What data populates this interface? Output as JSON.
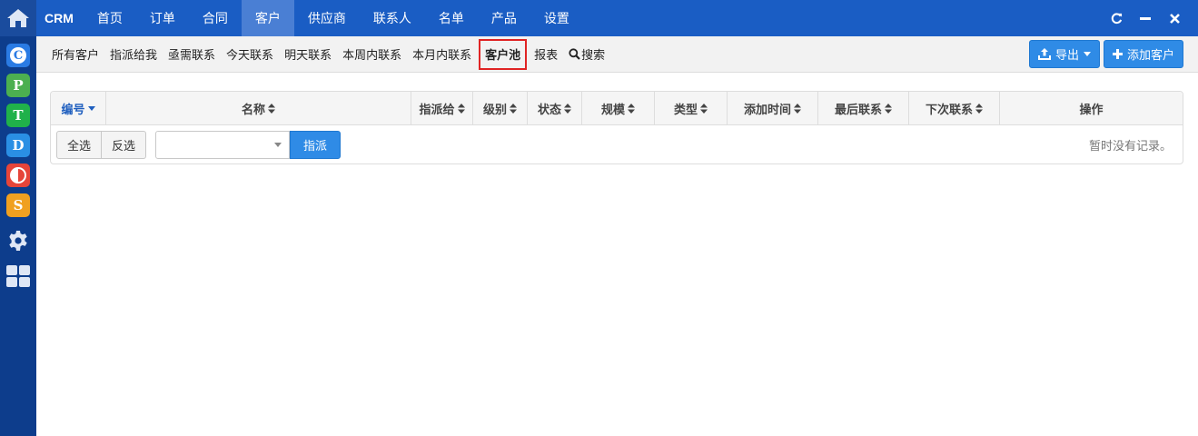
{
  "app": {
    "brand": "CRM"
  },
  "topnav": {
    "items": [
      {
        "label": "首页"
      },
      {
        "label": "订单"
      },
      {
        "label": "合同"
      },
      {
        "label": "客户",
        "active": true
      },
      {
        "label": "供应商"
      },
      {
        "label": "联系人"
      },
      {
        "label": "名单"
      },
      {
        "label": "产品"
      },
      {
        "label": "设置"
      }
    ]
  },
  "sidebar": {
    "apps": [
      {
        "letter": "C",
        "color": "#2a7be4",
        "icon": "crm-app-icon"
      },
      {
        "letter": "P",
        "color": "#4caf50",
        "icon": "project-app-icon"
      },
      {
        "letter": "T",
        "color": "#20b14a",
        "icon": "task-app-icon"
      },
      {
        "letter": "D",
        "color": "#2a8fe4",
        "icon": "doc-app-icon"
      },
      {
        "letter": "O",
        "color": "#e6453a",
        "icon": "oa-app-icon"
      },
      {
        "letter": "S",
        "color": "#f0a020",
        "icon": "s-app-icon"
      }
    ]
  },
  "subnav": {
    "items": [
      {
        "label": "所有客户"
      },
      {
        "label": "指派给我"
      },
      {
        "label": "亟需联系"
      },
      {
        "label": "今天联系"
      },
      {
        "label": "明天联系"
      },
      {
        "label": "本周内联系"
      },
      {
        "label": "本月内联系"
      },
      {
        "label": "客户池",
        "active": true
      },
      {
        "label": "报表"
      },
      {
        "label": "搜索",
        "icon": "search-icon"
      }
    ],
    "export_label": "导出",
    "add_label": "添加客户"
  },
  "table": {
    "columns": [
      {
        "label": "编号",
        "sort": "desc"
      },
      {
        "label": "名称",
        "sort": "both"
      },
      {
        "label": "指派给",
        "sort": "both"
      },
      {
        "label": "级别",
        "sort": "both"
      },
      {
        "label": "状态",
        "sort": "both"
      },
      {
        "label": "规模",
        "sort": "both"
      },
      {
        "label": "类型",
        "sort": "both"
      },
      {
        "label": "添加时间",
        "sort": "both"
      },
      {
        "label": "最后联系",
        "sort": "both"
      },
      {
        "label": "下次联系",
        "sort": "both"
      },
      {
        "label": "操作",
        "sort": "none"
      }
    ],
    "select_all_label": "全选",
    "invert_label": "反选",
    "assign_select_value": "",
    "assign_label": "指派",
    "empty_message": "暂时没有记录。"
  },
  "colors": {
    "navbar": "#1a5dc4",
    "nav_active": "#4a7fd4",
    "sidebar": "#0d3d8c",
    "primary_button": "#2f8be6",
    "highlight_border": "#e02424"
  }
}
